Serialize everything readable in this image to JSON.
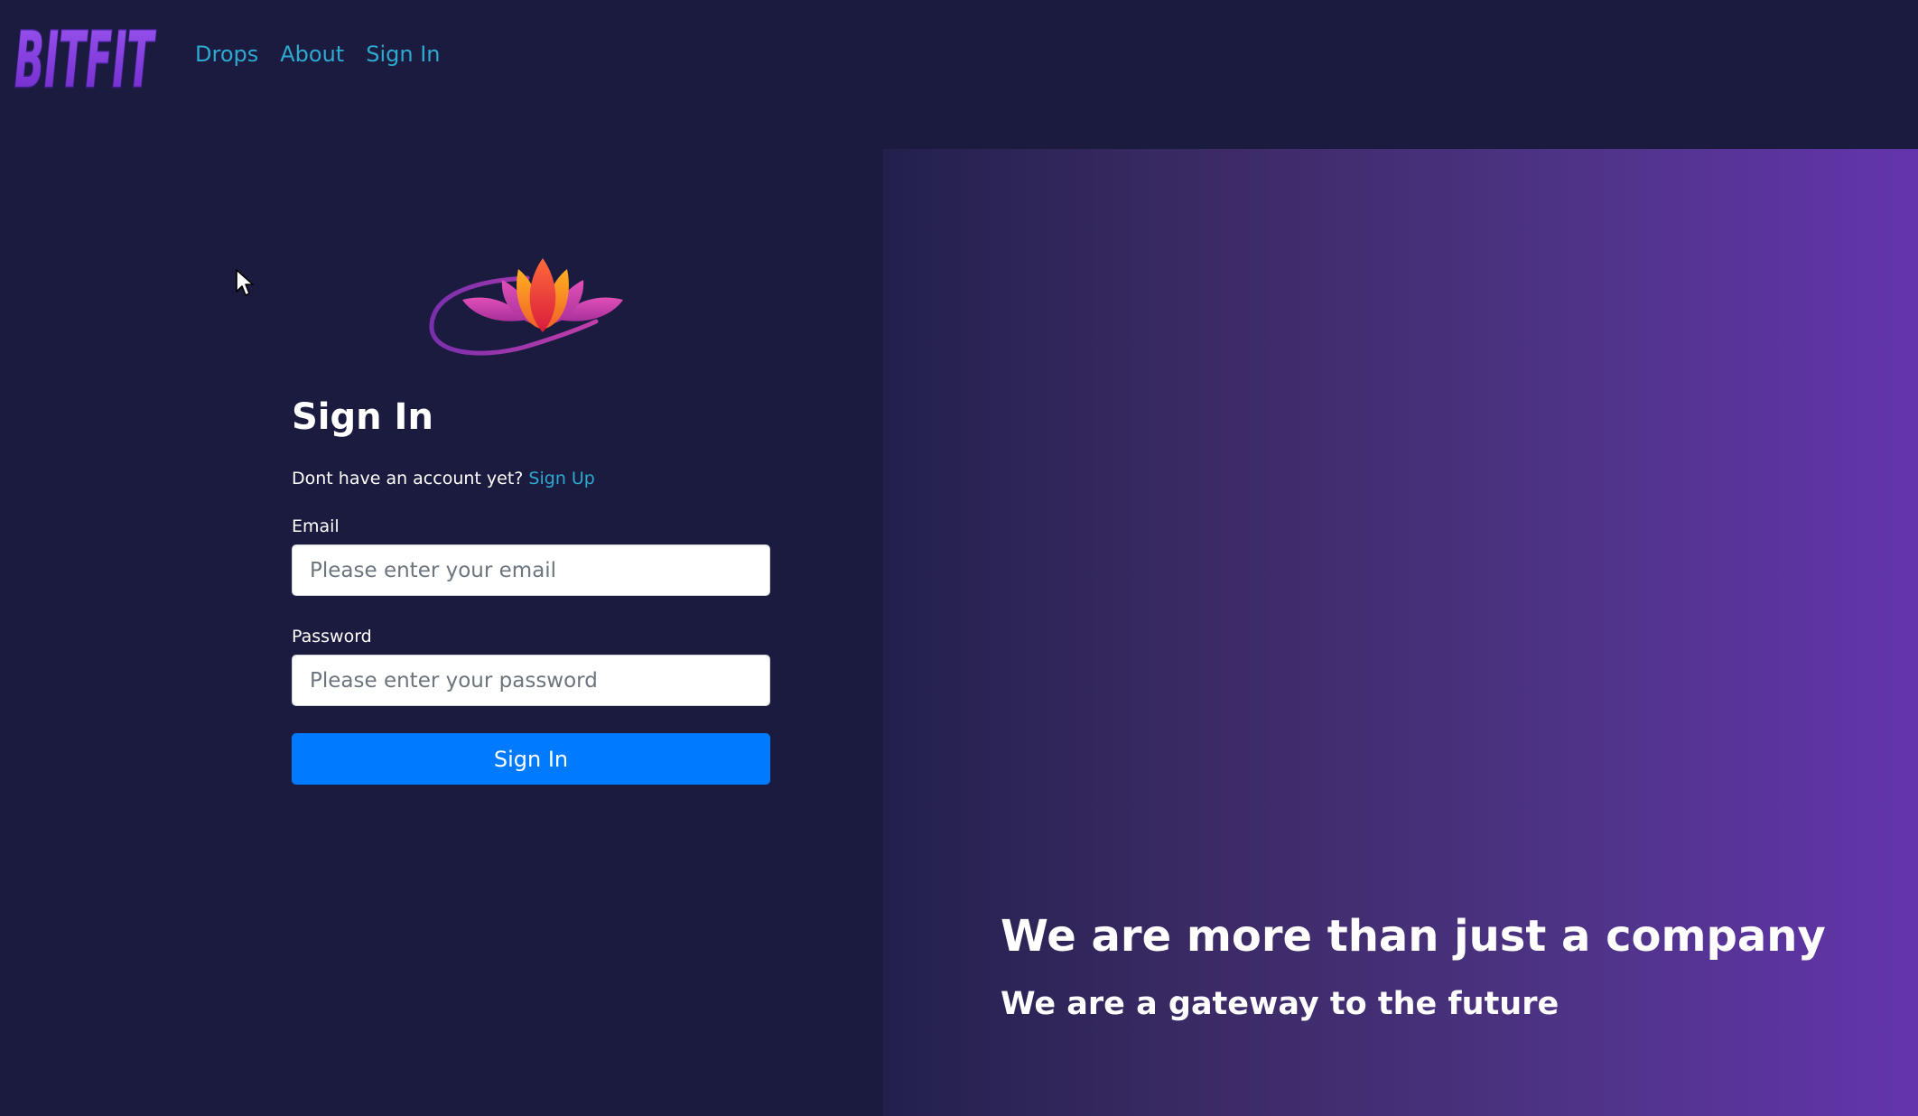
{
  "brand": {
    "logo_text": "BITFIT",
    "logo_icon": "bitfit-logo"
  },
  "nav": {
    "items": [
      {
        "label": "Drops"
      },
      {
        "label": "About"
      },
      {
        "label": "Sign In"
      }
    ]
  },
  "form": {
    "logo_icon": "lotus-flower-logo",
    "title": "Sign In",
    "signup_prompt": "Dont have an account yet?",
    "signup_link": "Sign Up",
    "email_label": "Email",
    "email_placeholder": "Please enter your email",
    "email_value": "",
    "password_label": "Password",
    "password_placeholder": "Please enter your password",
    "password_value": "",
    "submit_label": "Sign In"
  },
  "hero": {
    "title": "We are more than just a company",
    "subtitle": "We are a gateway to the future"
  },
  "colors": {
    "page_background": "#1b1a3f",
    "link": "#2ea9cf",
    "primary_button": "#007bff",
    "hero_gradient_start": "#23204d",
    "hero_gradient_end": "#6335ad",
    "logo_purple": "#8a3ee6"
  },
  "cursor": {
    "icon": "mouse-pointer-icon"
  }
}
